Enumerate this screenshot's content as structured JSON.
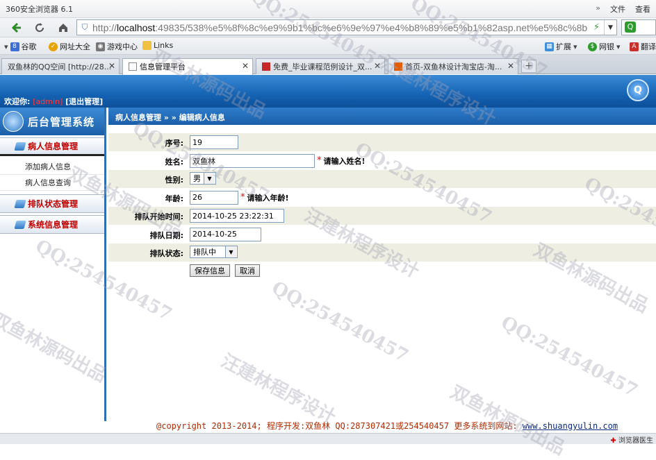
{
  "browser": {
    "app_title": "360安全浏览器 6.1",
    "menu": [
      "»",
      "文件",
      "查看"
    ],
    "url_prefix": "http://",
    "url_host": "localhost",
    "url_rest": ":49835/538%e5%8f%8c%e9%9b1%bc%e6%9e%97%e4%b8%89%e5%b1%82asp.net%e5%8c%8b",
    "favorites": [
      "谷歌",
      "网址大全",
      "游戏中心",
      "Links",
      "扩展",
      "网银",
      "翻译"
    ],
    "tabs": [
      {
        "label": "双鱼林的QQ空间 [http://28..."
      },
      {
        "label": "信息管理平台"
      },
      {
        "label": "免费_毕业课程范例设计_双..."
      },
      {
        "label": "首页-双鱼林设计淘宝店-淘..."
      }
    ],
    "close_glyph": "✕",
    "newtab_glyph": "+",
    "status_text": "浏览器医生"
  },
  "header": {
    "welcome_prefix": "欢迎你:",
    "user": "[admin]",
    "logout": "[退出管理]"
  },
  "sidebar": {
    "brand": "后台管理系统",
    "groups": [
      {
        "label": "病人信息管理",
        "items": [
          "添加病人信息",
          "病人信息查询"
        ]
      },
      {
        "label": "排队状态管理"
      },
      {
        "label": "系统信息管理"
      }
    ]
  },
  "breadcrumb": "病人信息管理 » » 编辑病人信息",
  "form": {
    "id_label": "序号:",
    "id_value": "19",
    "name_label": "姓名:",
    "name_value": "双鱼林",
    "name_hint": "请输入姓名!",
    "gender_label": "性别:",
    "gender_value": "男",
    "age_label": "年龄:",
    "age_value": "26",
    "age_hint": "请输入年龄!",
    "start_label": "排队开始时间:",
    "start_value": "2014-10-25 23:22:31",
    "date_label": "排队日期:",
    "date_value": "2014-10-25",
    "status_label": "排队状态:",
    "status_value": "排队中",
    "required_mark": "*",
    "save_label": "保存信息",
    "cancel_label": "取消"
  },
  "footer": {
    "text": "@copyright 2013-2014; 程序开发:双鱼林  QQ:287307421或254540457  更多系统到网站:",
    "site": "www.shuangyulin.com"
  },
  "watermarks": {
    "qq": "QQ:254540457",
    "author": "汪建林程序设计",
    "source": "双鱼林源码出品"
  }
}
